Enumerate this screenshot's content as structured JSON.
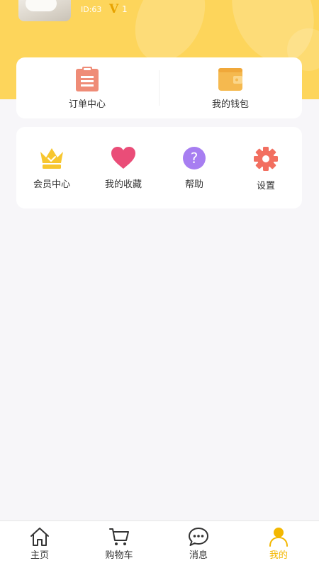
{
  "profile": {
    "user_id": "ID:63",
    "vip_badge": "V",
    "vip_level": "1"
  },
  "quick_actions": [
    {
      "label": "订单中心",
      "icon": "clipboard-icon",
      "color": "#ef8c77"
    },
    {
      "label": "我的钱包",
      "icon": "wallet-icon",
      "color": "#f5b94f"
    }
  ],
  "services": [
    {
      "label": "会员中心",
      "icon": "crown-icon",
      "color": "#f7c62f"
    },
    {
      "label": "我的收藏",
      "icon": "heart-icon",
      "color": "#ea4d78"
    },
    {
      "label": "帮助",
      "icon": "question-icon",
      "color": "#a77ef1"
    },
    {
      "label": "设置",
      "icon": "gear-icon",
      "color": "#f26f60"
    }
  ],
  "tabbar": {
    "items": [
      {
        "label": "主页",
        "icon": "home-icon"
      },
      {
        "label": "购物车",
        "icon": "cart-icon"
      },
      {
        "label": "消息",
        "icon": "message-icon"
      },
      {
        "label": "我的",
        "icon": "person-icon",
        "active": true
      }
    ]
  },
  "colors": {
    "header_bg": "#fdd55b",
    "page_bg": "#f7f6f9",
    "active_tab": "#f3b700",
    "vip_gold": "#e7a300"
  }
}
